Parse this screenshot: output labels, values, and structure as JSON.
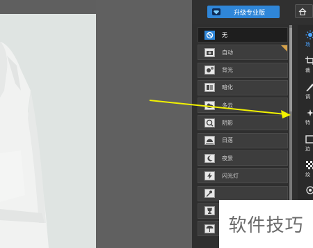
{
  "toolbar": {
    "upgrade_label": "升级专业版"
  },
  "scenes": [
    {
      "label": "无",
      "icon": "no-icon",
      "active": true
    },
    {
      "label": "自动",
      "icon": "camera-icon",
      "active": false
    },
    {
      "label": "背光",
      "icon": "backlight-icon",
      "active": false
    },
    {
      "label": "暗化",
      "icon": "darken-icon",
      "active": false
    },
    {
      "label": "多云",
      "icon": "cloud-icon",
      "active": false
    },
    {
      "label": "阴影",
      "icon": "shadow-icon",
      "active": false
    },
    {
      "label": "日落",
      "icon": "sunset-icon",
      "active": false
    },
    {
      "label": "夜景",
      "icon": "moon-icon",
      "active": false
    },
    {
      "label": "闪光灯",
      "icon": "flash-icon",
      "active": false
    },
    {
      "label": "",
      "icon": "fireworks-icon",
      "active": false
    },
    {
      "label": "",
      "icon": "trophy-icon",
      "active": false
    },
    {
      "label": "",
      "icon": "beach-icon",
      "active": false
    }
  ],
  "tools": [
    {
      "label": "场",
      "icon": "scene-icon",
      "active": true
    },
    {
      "label": "裁",
      "icon": "crop-icon",
      "active": false
    },
    {
      "label": "调",
      "icon": "adjust-icon",
      "active": false
    },
    {
      "label": "特",
      "icon": "effects-icon",
      "active": false
    },
    {
      "label": "边",
      "icon": "border-icon",
      "active": false
    },
    {
      "label": "纹",
      "icon": "texture-icon",
      "active": false
    }
  ],
  "watermark": "软件技巧",
  "colors": {
    "accent": "#2f86d8",
    "panel": "#2f2f2f",
    "arrow": "#f2f200",
    "badge": "#d6a24a"
  }
}
